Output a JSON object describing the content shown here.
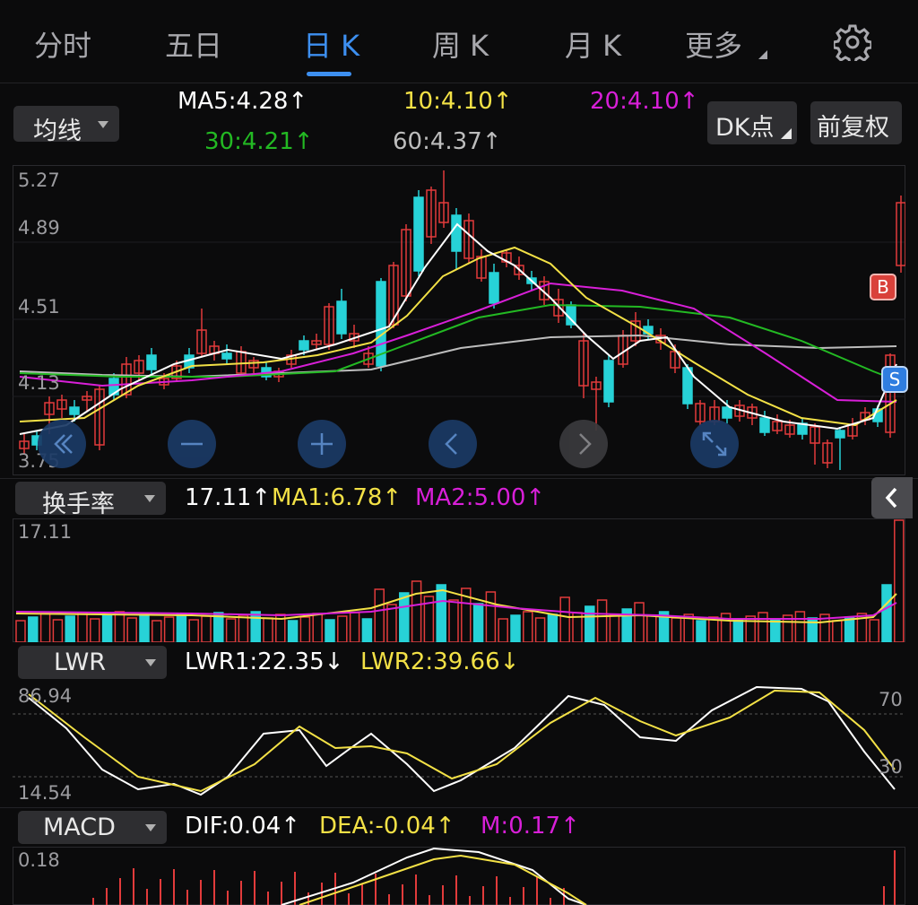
{
  "tabs": [
    {
      "label": "分时"
    },
    {
      "label": "五日"
    },
    {
      "label": "日 K"
    },
    {
      "label": "周 K"
    },
    {
      "label": "月 K"
    },
    {
      "label": "更多"
    }
  ],
  "ma_bar": {
    "select_label": "均线",
    "ma5": "MA5:4.28↑",
    "ma10": "10:4.10↑",
    "ma20": "20:4.10↑",
    "ma30": "30:4.21↑",
    "ma60": "60:4.37↑",
    "dk_label": "DK点",
    "adjust_label": "前复权"
  },
  "kline_axis": {
    "top": "5.27",
    "l2": "4.89",
    "l3": "4.51",
    "l4": "4.13",
    "bottom": "3.75"
  },
  "markers": {
    "buy": "B",
    "sell": "S"
  },
  "turnover": {
    "select_label": "换手率",
    "value": "17.11↑",
    "ma1": "MA1:6.78↑",
    "ma2": "MA2:5.00↑",
    "axis_top": "17.11"
  },
  "lwr": {
    "select_label": "LWR",
    "lwr1": "LWR1:22.35↓",
    "lwr2": "LWR2:39.66↓",
    "axis_top": "86.94",
    "axis_bottom": "14.54",
    "level_70": "70",
    "level_30": "30"
  },
  "macd": {
    "select_label": "MACD",
    "dif": "DIF:0.04↑",
    "dea": "DEA:-0.04↑",
    "m": "M:0.17↑",
    "axis_top": "0.18"
  },
  "colors": {
    "up": "#e23b3b",
    "down": "#27d2d7",
    "ma5": "#ffffff",
    "ma10": "#f3e146",
    "ma20": "#d81fd8",
    "ma30": "#23b923",
    "ma60": "#bdbdbd",
    "accent": "#3d8ff0"
  },
  "icons": [
    "gear-icon",
    "double-left-icon",
    "zoom-out-icon",
    "zoom-in-icon",
    "left-icon",
    "right-icon",
    "fullscreen-icon",
    "collapse-icon"
  ]
}
